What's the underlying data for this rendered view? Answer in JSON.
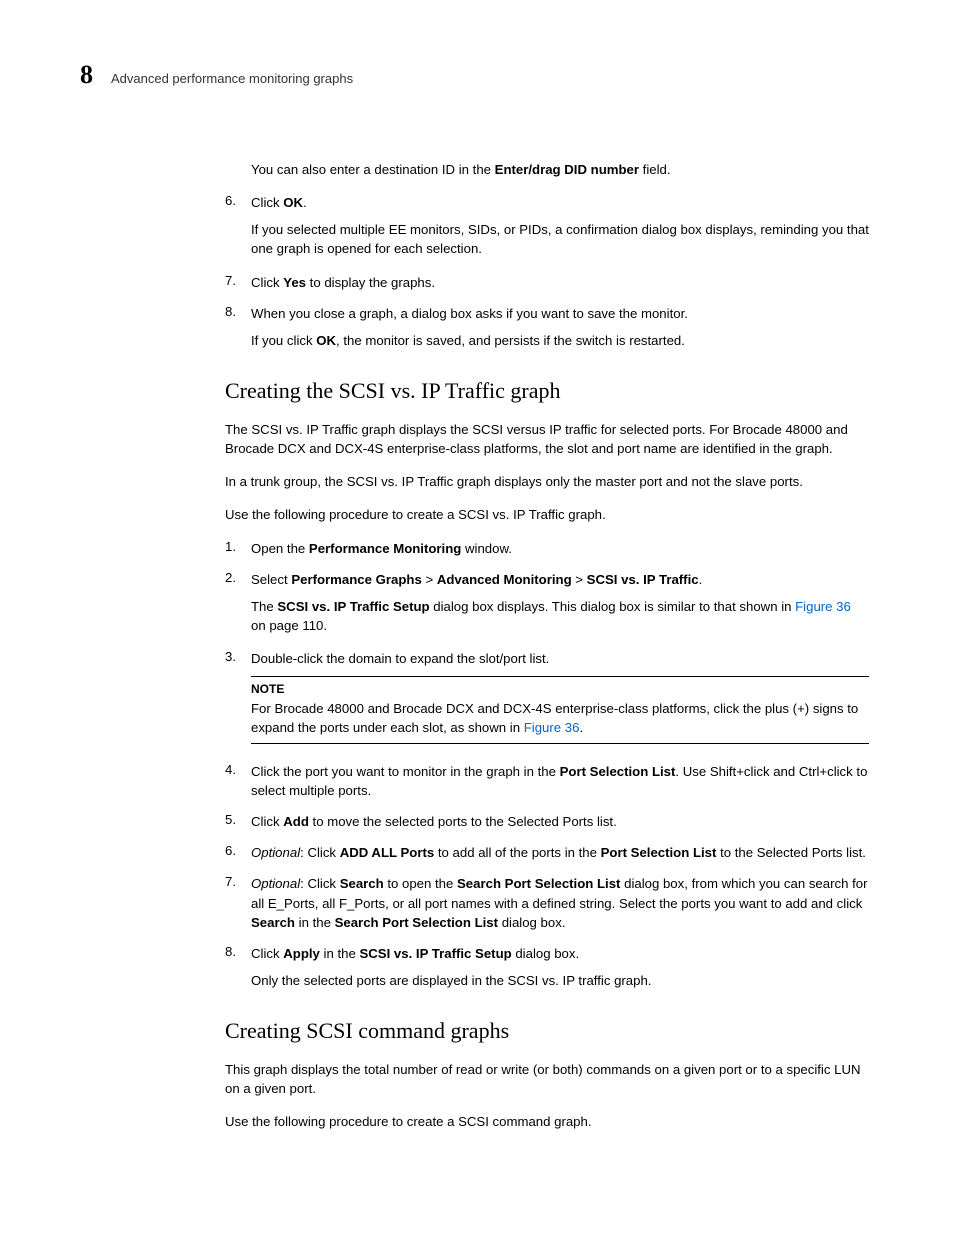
{
  "header": {
    "chapter": "8",
    "title": "Advanced performance monitoring graphs"
  },
  "intro": {
    "p1_a": "You can also enter a destination ID in the ",
    "p1_b": "Enter/drag DID number",
    "p1_c": " field."
  },
  "steps_top": [
    {
      "num": "6.",
      "text_a": "Click ",
      "bold": "OK",
      "text_b": ".",
      "sub": "If you selected multiple EE monitors, SIDs, or PIDs, a confirmation dialog box displays, reminding you that one graph is opened for each selection."
    },
    {
      "num": "7.",
      "text_a": "Click ",
      "bold": "Yes",
      "text_b": " to display the graphs."
    },
    {
      "num": "8.",
      "text_a": "When you close a graph, a dialog box asks if you want to save the monitor.",
      "sub_a": "If you click ",
      "sub_bold": "OK",
      "sub_b": ", the monitor is saved, and persists if the switch is restarted."
    }
  ],
  "section1": {
    "title": "Creating the SCSI vs. IP Traffic graph",
    "p1": "The SCSI vs. IP Traffic graph displays the SCSI versus IP traffic for selected ports. For Brocade 48000 and Brocade DCX and DCX-4S enterprise-class platforms, the slot and port name are identified in the graph.",
    "p2": "In a trunk group, the SCSI vs. IP Traffic graph displays only the master port and not the slave ports.",
    "p3": "Use the following procedure to create a SCSI vs. IP Traffic graph.",
    "steps": {
      "s1": {
        "num": "1.",
        "a": "Open the ",
        "b": "Performance Monitoring",
        "c": " window."
      },
      "s2": {
        "num": "2.",
        "a": "Select ",
        "b": "Performance Graphs",
        "c": " > ",
        "d": "Advanced Monitoring",
        "e": " > ",
        "f": "SCSI vs. IP Traffic",
        "g": ".",
        "sub_a": "The ",
        "sub_b": "SCSI vs. IP Traffic Setup",
        "sub_c": " dialog box displays. This dialog box is similar to that shown in ",
        "sub_link": "Figure 36",
        "sub_d": " on page 110."
      },
      "s3": {
        "num": "3.",
        "a": "Double-click the domain to expand the slot/port list."
      },
      "note": {
        "title": "NOTE",
        "a": "For Brocade 48000 and Brocade DCX and DCX-4S enterprise-class platforms, click the plus (+) signs to expand the ports under each slot, as shown in ",
        "link": "Figure 36",
        "b": "."
      },
      "s4": {
        "num": "4.",
        "a": "Click the port you want to monitor in the graph in the ",
        "b": "Port Selection List",
        "c": ". Use Shift+click and Ctrl+click to select multiple ports."
      },
      "s5": {
        "num": "5.",
        "a": "Click ",
        "b": "Add",
        "c": " to move the selected ports to the Selected Ports list."
      },
      "s6": {
        "num": "6.",
        "opt": "Optional",
        "a": ": Click ",
        "b": "ADD ALL Ports",
        "c": " to add all of the ports in the ",
        "d": "Port Selection List",
        "e": " to the Selected Ports list."
      },
      "s7": {
        "num": "7.",
        "opt": "Optional",
        "a": ": Click ",
        "b": "Search",
        "c": " to open the ",
        "d": "Search Port Selection List",
        "e": " dialog box, from which you can search for all E_Ports, all F_Ports, or all port names with a defined string. Select the ports you want to add and click ",
        "f": "Search",
        "g": " in the ",
        "h": "Search Port Selection List",
        "i": " dialog box."
      },
      "s8": {
        "num": "8.",
        "a": "Click ",
        "b": "Apply",
        "c": " in the ",
        "d": "SCSI vs. IP Traffic Setup",
        "e": " dialog box.",
        "sub": "Only the selected ports are displayed in the SCSI vs. IP traffic graph."
      }
    }
  },
  "section2": {
    "title": "Creating SCSI command graphs",
    "p1": "This graph displays the total number of read or write (or both) commands on a given port or to a specific LUN on a given port.",
    "p2": "Use the following procedure to create a SCSI command graph."
  }
}
